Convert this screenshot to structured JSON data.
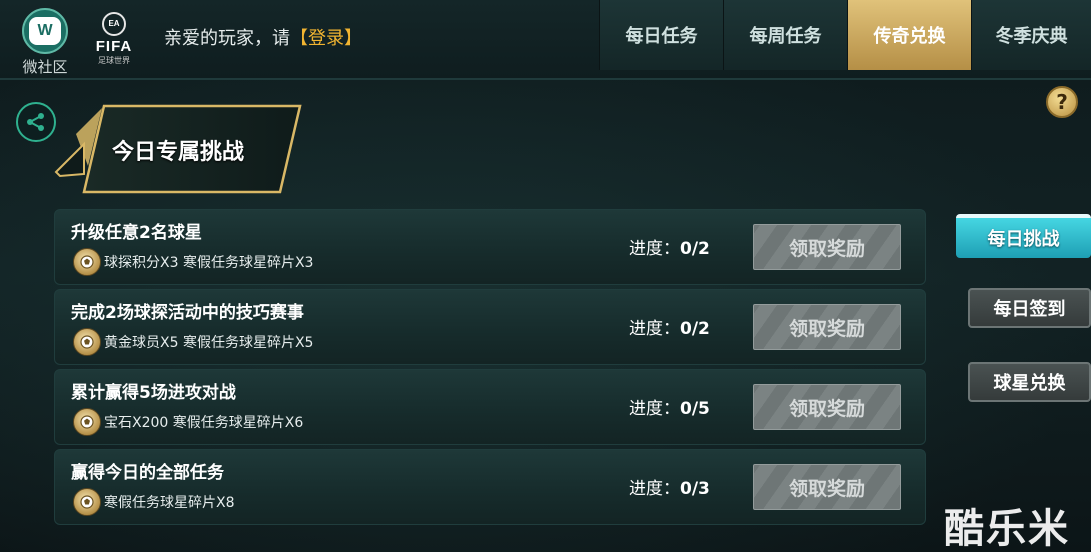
{
  "header": {
    "wechat_label": "微社区",
    "wechat_logo_letter": "W",
    "fifa_ea": "EA SPORTS",
    "fifa_name": "FIFA",
    "fifa_sub": "足球世界",
    "greeting_prefix": "亲爱的玩家，请",
    "login_link": "【登录】",
    "tabs": [
      {
        "label": "每日任务",
        "active": false
      },
      {
        "label": "每周任务",
        "active": false
      },
      {
        "label": "传奇兑换",
        "active": true
      },
      {
        "label": "冬季庆典",
        "active": false
      }
    ]
  },
  "banner": {
    "title": "今日专属挑战"
  },
  "help_symbol": "?",
  "tasks": [
    {
      "title": "升级任意2名球星",
      "reward": "球探积分X3 寒假任务球星碎片X3",
      "progress_label": "进度：",
      "progress_value": "0/2",
      "button": "领取奖励"
    },
    {
      "title": "完成2场球探活动中的技巧赛事",
      "reward": "黄金球员X5 寒假任务球星碎片X5",
      "progress_label": "进度：",
      "progress_value": "0/2",
      "button": "领取奖励"
    },
    {
      "title": "累计赢得5场进攻对战",
      "reward": "宝石X200 寒假任务球星碎片X6",
      "progress_label": "进度：",
      "progress_value": "0/5",
      "button": "领取奖励"
    },
    {
      "title": "赢得今日的全部任务",
      "reward": "寒假任务球星碎片X8",
      "progress_label": "进度：",
      "progress_value": "0/3",
      "button": "领取奖励"
    }
  ],
  "side_menu": [
    {
      "label": "每日挑战",
      "active": true
    },
    {
      "label": "每日签到",
      "active": false
    },
    {
      "label": "球星兑换",
      "active": false
    }
  ],
  "watermark": "酷乐米",
  "colors": {
    "accent_gold": "#f1b431",
    "active_tab": "#c9a35c",
    "active_side": "#2fb9ca",
    "share_green": "#2fb18f"
  }
}
